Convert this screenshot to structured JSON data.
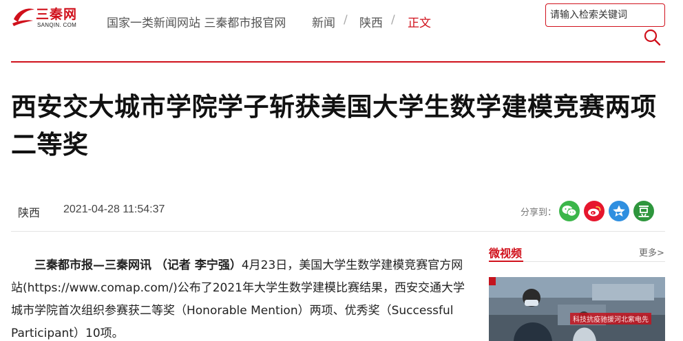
{
  "header": {
    "logo_text_cn": "三秦网",
    "logo_text_en": "SANQIN. COM",
    "site_desc": "国家一类新闻网站 三秦都市报官网",
    "breadcrumb": [
      {
        "label": "新闻",
        "active": false
      },
      {
        "label": "陕西",
        "active": false
      },
      {
        "label": "正文",
        "active": true
      }
    ],
    "breadcrumb_sep": "/",
    "search": {
      "placeholder": "请输入检索关键词",
      "value": ""
    }
  },
  "article": {
    "title": "西安交大城市学院学子斩获美国大学生数学建模竞赛两项二等奖",
    "source": "陕西",
    "datetime": "2021-04-28 11:54:37",
    "share_label": "分享到：",
    "share_targets": [
      {
        "name": "wechat",
        "color": "#3bb64a"
      },
      {
        "name": "weibo",
        "color": "#e6162d"
      },
      {
        "name": "qzone",
        "color": "#2f8fe0"
      },
      {
        "name": "douban",
        "color": "#2e963d"
      }
    ],
    "lead": "三秦都市报—三秦网讯 （记者 李宁强）",
    "body": "4月23日，美国大学生数学建模竞赛官方网站(https://www.comap.com/)公布了2021年大学生数学建模比赛结果，西安交通大学城市学院首次组织参赛获二等奖（Honorable Mention）两项、优秀奖（Successful Participant）10项。"
  },
  "sidebar": {
    "section_title": "微视频",
    "more_label": "更多>",
    "video_banner": "科技抗疫驰援河北紫电先"
  },
  "colors": {
    "brand_red": "#d0101b"
  }
}
